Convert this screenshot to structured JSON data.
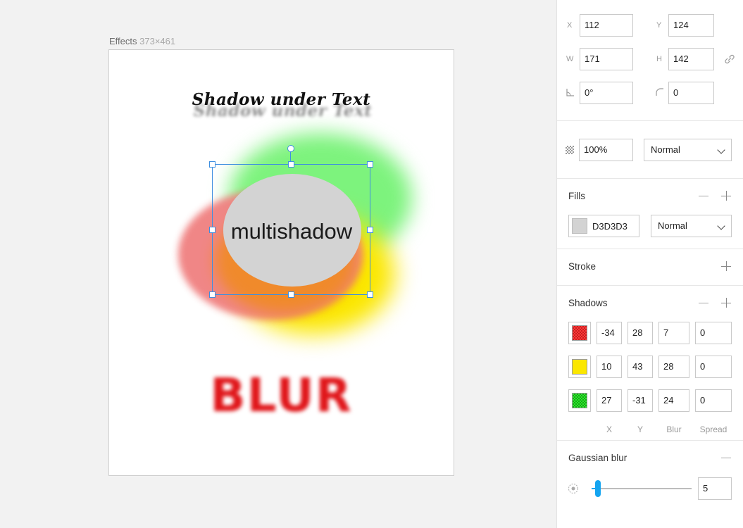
{
  "artboard": {
    "name": "Effects",
    "dimensions": "373×461"
  },
  "canvas": {
    "shadow_text": "Shadow under Text",
    "multishadow_text": "multishadow",
    "blur_text": "BLUR"
  },
  "inspector": {
    "position": {
      "x_label": "X",
      "x_value": "112",
      "y_label": "Y",
      "y_value": "124",
      "w_label": "W",
      "w_value": "171",
      "h_label": "H",
      "h_value": "142",
      "angle_value": "0°",
      "radius_value": "0",
      "link_icon": "link-icon"
    },
    "opacity": {
      "value": "100%",
      "blend_mode": "Normal"
    },
    "fills": {
      "title": "Fills",
      "items": [
        {
          "hex": "D3D3D3",
          "color": "#D3D3D3",
          "blend_mode": "Normal"
        }
      ]
    },
    "stroke": {
      "title": "Stroke"
    },
    "shadows": {
      "title": "Shadows",
      "items": [
        {
          "color": "#ff3b3b",
          "x": "-34",
          "y": "28",
          "blur": "7",
          "spread": "0"
        },
        {
          "color": "#fbe700",
          "x": "10",
          "y": "43",
          "blur": "28",
          "spread": "0"
        },
        {
          "color": "#2ee82e",
          "x": "27",
          "y": "-31",
          "blur": "24",
          "spread": "0"
        }
      ],
      "columns": [
        "X",
        "Y",
        "Blur",
        "Spread"
      ]
    },
    "gaussian_blur": {
      "title": "Gaussian blur",
      "value": "5",
      "slider_fraction": 0.06
    }
  }
}
